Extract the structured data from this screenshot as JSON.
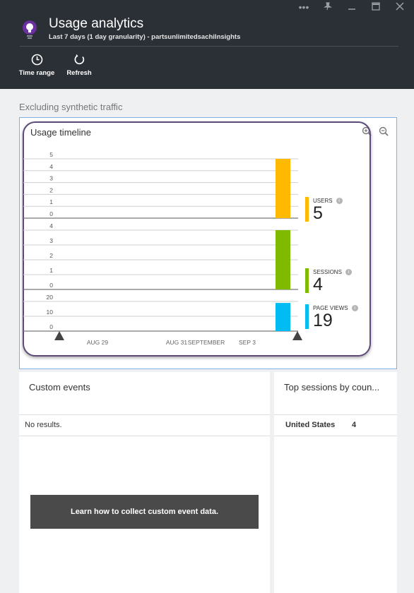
{
  "header": {
    "title": "Usage analytics",
    "subtitle": "Last 7 days (1 day granularity) - partsunlimitedsachiInsights",
    "commands": [
      {
        "label": "Time range",
        "icon": "clock-icon"
      },
      {
        "label": "Refresh",
        "icon": "refresh-icon"
      }
    ],
    "window_controls": [
      "more-icon",
      "pin-icon",
      "minimize-icon",
      "maximize-icon",
      "close-icon"
    ]
  },
  "section_label": "Excluding synthetic traffic",
  "timeline": {
    "title": "Usage timeline",
    "metrics": [
      {
        "label": "USERS",
        "value": "5",
        "color": "#ffb900"
      },
      {
        "label": "SESSIONS",
        "value": "4",
        "color": "#7fba00"
      },
      {
        "label": "PAGE VIEWS",
        "value": "19",
        "color": "#00bcf2"
      }
    ]
  },
  "chart_data": {
    "type": "bar",
    "x_tick_labels": [
      "AUG 29",
      "AUG 31",
      "SEPTEMBER",
      "SEP 3"
    ],
    "panels": [
      {
        "series": "Users",
        "y_ticks": [
          0,
          1,
          2,
          3,
          4,
          5
        ],
        "ylim": [
          0,
          5
        ],
        "last_value": 5,
        "color": "#ffb900"
      },
      {
        "series": "Sessions",
        "y_ticks": [
          0,
          1,
          2,
          3,
          4
        ],
        "ylim": [
          0,
          4
        ],
        "last_value": 4,
        "color": "#7fba00"
      },
      {
        "series": "Page views",
        "y_ticks": [
          0,
          10,
          20
        ],
        "ylim": [
          0,
          20
        ],
        "last_value": 19,
        "color": "#00bcf2"
      }
    ],
    "grid": true
  },
  "custom_events": {
    "title": "Custom events",
    "empty_text": "No results.",
    "learn_button": "Learn how to collect custom event data."
  },
  "top_sessions": {
    "title": "Top sessions by coun...",
    "rows": [
      {
        "country": "United States",
        "count": "4"
      }
    ]
  }
}
